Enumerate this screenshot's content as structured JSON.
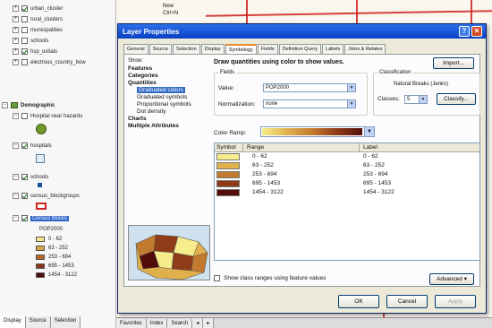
{
  "toc": {
    "layers": [
      {
        "label": "urban_cluster",
        "checked": true,
        "indent": 1
      },
      {
        "label": "rural_clusters",
        "checked": false,
        "indent": 1
      },
      {
        "label": "municipalities",
        "checked": false,
        "indent": 1
      },
      {
        "label": "schools",
        "checked": false,
        "indent": 1
      },
      {
        "label": "hsp_uvitals",
        "checked": true,
        "indent": 1
      },
      {
        "label": "electrous_country_bow",
        "checked": false,
        "indent": 1
      }
    ],
    "group_label": "Demographic",
    "group_layers": [
      {
        "label": "Hospital near hazards",
        "checked": false
      },
      {
        "label": "hospitals",
        "checked": true
      },
      {
        "label": "schools",
        "checked": true
      },
      {
        "label": "census_blockgroups",
        "checked": true
      },
      {
        "label": "Census blocks",
        "checked": true
      }
    ],
    "field_name": "POP2000",
    "legend": [
      {
        "label": "0 - 62",
        "color": "#f3e88a"
      },
      {
        "label": "63 - 252",
        "color": "#d9a347"
      },
      {
        "label": "253 - 694",
        "color": "#b8652a"
      },
      {
        "label": "695 - 1453",
        "color": "#8a3418"
      },
      {
        "label": "1454 - 3122",
        "color": "#4d0a08"
      }
    ],
    "tabs": [
      "Display",
      "Source",
      "Selection"
    ]
  },
  "map": {
    "tabs": [
      "Favorites",
      "Index",
      "Search"
    ],
    "top_items": [
      "New",
      "Ctrl+N"
    ]
  },
  "dialog": {
    "title": "Layer Properties",
    "tabs": [
      "General",
      "Source",
      "Selection",
      "Display",
      "Symbology",
      "Fields",
      "Definition Query",
      "Labels",
      "Joins & Relates"
    ],
    "active_tab": "Symbology",
    "show_label": "Show:",
    "tree": [
      {
        "label": "Features",
        "type": "cat"
      },
      {
        "label": "Categories",
        "type": "cat"
      },
      {
        "label": "Quantities",
        "type": "cat"
      },
      {
        "label": "Graduated colors",
        "type": "sub",
        "selected": true
      },
      {
        "label": "Graduated symbols",
        "type": "sub"
      },
      {
        "label": "Proportional symbols",
        "type": "sub"
      },
      {
        "label": "Dot density",
        "type": "sub"
      },
      {
        "label": "Charts",
        "type": "cat"
      },
      {
        "label": "Multiple Attributes",
        "type": "cat"
      }
    ],
    "heading": "Draw quantities using color to show values.",
    "import_label": "Import...",
    "fields": {
      "legend": "Fields",
      "value_label": "Value:",
      "value": "POP2000",
      "normalization_label": "Normalization:",
      "normalization": "none"
    },
    "classification": {
      "legend": "Classification",
      "method": "Natural Breaks (Jenks)",
      "classes_label": "Classes:",
      "classes": "5",
      "classify_label": "Classify..."
    },
    "color_ramp_label": "Color Ramp:",
    "table": {
      "headers": [
        "Symbol",
        "Range",
        "Label"
      ],
      "rows": [
        {
          "range": "0 - 62",
          "label": "0 - 62",
          "color": "#f6ec8c"
        },
        {
          "range": "63 - 252",
          "label": "63 - 252",
          "color": "#e0b04c"
        },
        {
          "range": "253 - 694",
          "label": "253 - 694",
          "color": "#c27a2e"
        },
        {
          "range": "695 - 1453",
          "label": "695 - 1453",
          "color": "#8e3b17"
        },
        {
          "range": "1454 - 3122",
          "label": "1454 - 3122",
          "color": "#520d0a"
        }
      ]
    },
    "show_ranges_label": "Show class ranges using feature values",
    "advanced_label": "Advanced",
    "ok_label": "OK",
    "cancel_label": "Cancel",
    "apply_label": "Apply"
  }
}
